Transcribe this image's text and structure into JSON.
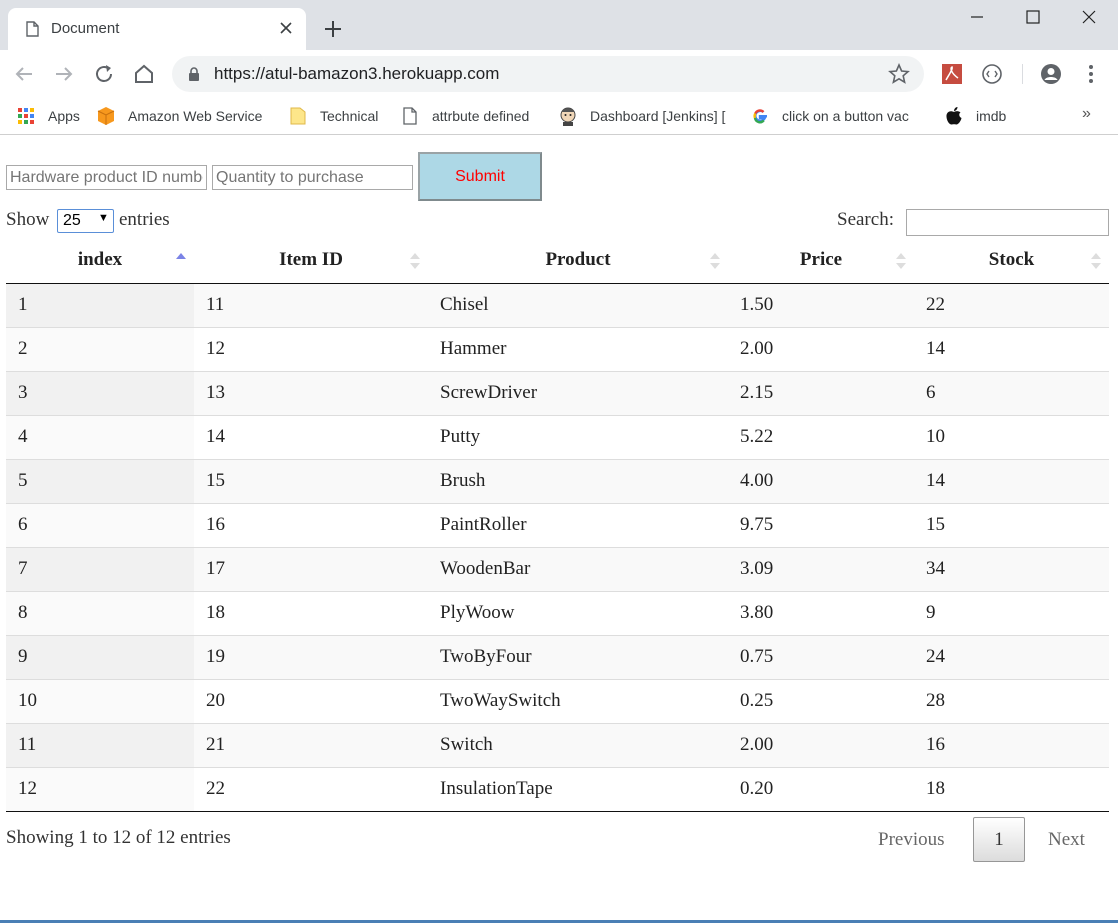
{
  "tab": {
    "title": "Document"
  },
  "address_bar": {
    "url": "https://atul-bamazon3.herokuapp.com"
  },
  "bookmarks": [
    {
      "label": "Apps",
      "icon": "apps-grid-icon"
    },
    {
      "label": "Amazon Web Service",
      "icon": "aws-cube-icon"
    },
    {
      "label": "Technical",
      "icon": "folder-icon"
    },
    {
      "label": "attrbute defined",
      "icon": "page-icon"
    },
    {
      "label": "Dashboard [Jenkins] [",
      "icon": "jenkins-icon"
    },
    {
      "label": "click on a button vac",
      "icon": "google-icon"
    },
    {
      "label": "imdb",
      "icon": "apple-icon"
    }
  ],
  "form": {
    "product_id_placeholder": "Hardware product ID number",
    "quantity_placeholder": "Quantity to purchase",
    "submit_label": "Submit"
  },
  "controls": {
    "show_label": "Show",
    "page_length": "25",
    "entries_label": "entries",
    "search_label": "Search:"
  },
  "table": {
    "columns": [
      "index",
      "Item ID",
      "Product",
      "Price",
      "Stock"
    ],
    "sorted_column": "index",
    "rows": [
      [
        "1",
        "11",
        "Chisel",
        "1.50",
        "22"
      ],
      [
        "2",
        "12",
        "Hammer",
        "2.00",
        "14"
      ],
      [
        "3",
        "13",
        "ScrewDriver",
        "2.15",
        "6"
      ],
      [
        "4",
        "14",
        "Putty",
        "5.22",
        "10"
      ],
      [
        "5",
        "15",
        "Brush",
        "4.00",
        "14"
      ],
      [
        "6",
        "16",
        "PaintRoller",
        "9.75",
        "15"
      ],
      [
        "7",
        "17",
        "WoodenBar",
        "3.09",
        "34"
      ],
      [
        "8",
        "18",
        "PlyWoow",
        "3.80",
        "9"
      ],
      [
        "9",
        "19",
        "TwoByFour",
        "0.75",
        "24"
      ],
      [
        "10",
        "20",
        "TwoWaySwitch",
        "0.25",
        "28"
      ],
      [
        "11",
        "21",
        "Switch",
        "2.00",
        "16"
      ],
      [
        "12",
        "22",
        "InsulationTape",
        "0.20",
        "18"
      ]
    ]
  },
  "footer": {
    "info": "Showing 1 to 12 of 12 entries",
    "previous": "Previous",
    "current_page": "1",
    "next": "Next"
  },
  "colors": {
    "submit_bg": "#add8e6",
    "submit_text": "#ff0000",
    "sort_active": "#7b83e6"
  }
}
